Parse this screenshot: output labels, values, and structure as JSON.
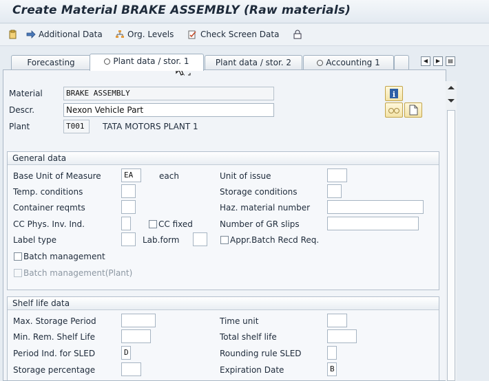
{
  "window": {
    "title": "Create Material BRAKE ASSEMBLY (Raw materials)"
  },
  "toolbar": {
    "additional_data": "Additional Data",
    "org_levels": "Org. Levels",
    "check_screen_data": "Check Screen Data"
  },
  "tabs": [
    {
      "label": "Forecasting"
    },
    {
      "label": "Plant data / stor. 1"
    },
    {
      "label": "Plant data / stor. 2"
    },
    {
      "label": "Accounting 1"
    }
  ],
  "header": {
    "material_label": "Material",
    "material_value": "BRAKE ASSEMBLY",
    "descr_label": "Descr.",
    "descr_value": "Nexon Vehicle Part",
    "plant_label": "Plant",
    "plant_code": "T001",
    "plant_name": "TATA MOTORS PLANT 1"
  },
  "general": {
    "title": "General data",
    "base_uom_label": "Base Unit of Measure",
    "base_uom_value": "EA",
    "base_uom_text": "each",
    "unit_issue_label": "Unit of issue",
    "temp_label": "Temp. conditions",
    "storage_cond_label": "Storage conditions",
    "container_label": "Container reqmts",
    "haz_label": "Haz. material number",
    "cc_phys_label": "CC Phys. Inv. Ind.",
    "cc_fixed_label": "CC fixed",
    "gr_slips_label": "Number of GR slips",
    "label_type_label": "Label type",
    "lab_form_label": "Lab.form",
    "appr_batch_label": "Appr.Batch Recd Req.",
    "batch_mgmt_label": "Batch management",
    "batch_mgmt_plant_label": "Batch management(Plant)"
  },
  "shelf": {
    "title": "Shelf life data",
    "max_storage_label": "Max. Storage Period",
    "time_unit_label": "Time unit",
    "min_rem_label": "Min. Rem. Shelf Life",
    "total_shelf_label": "Total shelf life",
    "period_ind_label": "Period Ind. for SLED",
    "period_ind_value": "D",
    "rounding_label": "Rounding rule SLED",
    "storage_pct_label": "Storage percentage",
    "expiration_label": "Expiration Date",
    "expiration_value": "B"
  }
}
